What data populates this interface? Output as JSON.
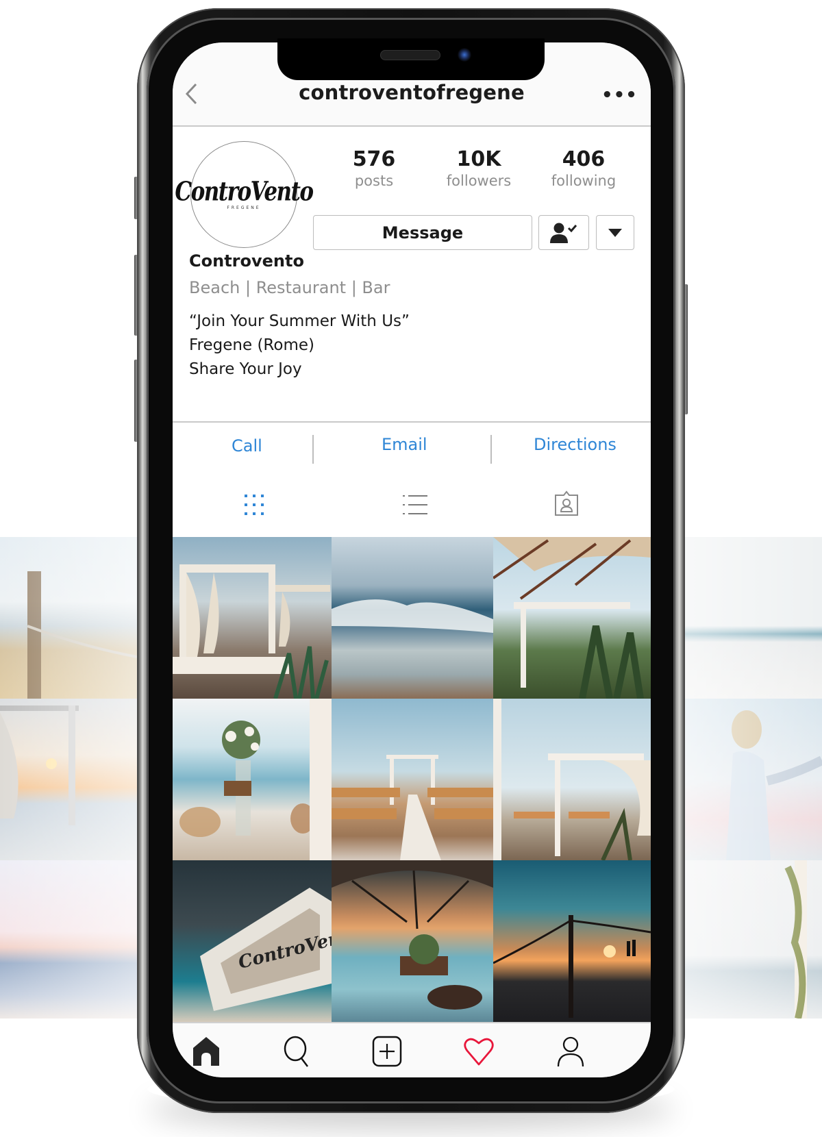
{
  "header": {
    "title": "controventofregene",
    "back_icon": "chevron-left-icon",
    "more_icon": "more-horizontal-icon",
    "more_label": "•••"
  },
  "profile": {
    "avatar_logo": "ControVento",
    "avatar_logo_sub": "FREGENE",
    "stats": [
      {
        "value": "576",
        "label": "posts"
      },
      {
        "value": "10K",
        "label": "followers"
      },
      {
        "value": "406",
        "label": "following"
      }
    ],
    "message_label": "Message",
    "following_icon": "user-check-icon",
    "dropdown_icon": "caret-down-icon",
    "name": "Controvento",
    "category": "Beach | Restaurant | Bar",
    "bio": [
      "“Join Your Summer With Us”",
      "Fregene (Rome)",
      "Share Your Joy"
    ]
  },
  "actions": [
    {
      "label": "Call"
    },
    {
      "label": "Email"
    },
    {
      "label": "Directions"
    }
  ],
  "colors": {
    "accent_blue": "#2f86d6",
    "heart_red": "#e8173b",
    "muted_text": "#8e8e8e"
  },
  "tabs": [
    {
      "name": "grid-view",
      "icon": "grid-icon",
      "active": true
    },
    {
      "name": "list-view",
      "icon": "list-icon",
      "active": false
    },
    {
      "name": "tagged",
      "icon": "tagged-user-icon",
      "active": false
    }
  ],
  "grid": [
    {
      "description": "Beach cabanas with white curtains and plants"
    },
    {
      "description": "Wave breaking on the shore"
    },
    {
      "description": "Umbrella over beach cabana with palm leaves"
    },
    {
      "description": "Table with flower vase and jars"
    },
    {
      "description": "Beach wedding aisle with arch and chairs"
    },
    {
      "description": "White cabana with wedding chairs"
    },
    {
      "description": "ControVento restaurant sign"
    },
    {
      "description": "Sunset dinner table under umbrella"
    },
    {
      "description": "Sunset over sea with rope and post"
    }
  ],
  "side_photos": {
    "left": [
      "Beach post with rope",
      "Cabana framing sunset",
      "Pastel sea shore"
    ],
    "right": [
      "Seaside dining table",
      "Bride holding hands",
      "Wedding arch with ivy"
    ]
  },
  "bottom_nav": [
    {
      "name": "home",
      "icon": "home-icon",
      "active": true
    },
    {
      "name": "search",
      "icon": "search-icon",
      "active": false
    },
    {
      "name": "new-post",
      "icon": "add-post-icon",
      "active": false
    },
    {
      "name": "activity",
      "icon": "heart-icon",
      "active": false
    },
    {
      "name": "profile",
      "icon": "profile-icon",
      "active": false
    }
  ]
}
